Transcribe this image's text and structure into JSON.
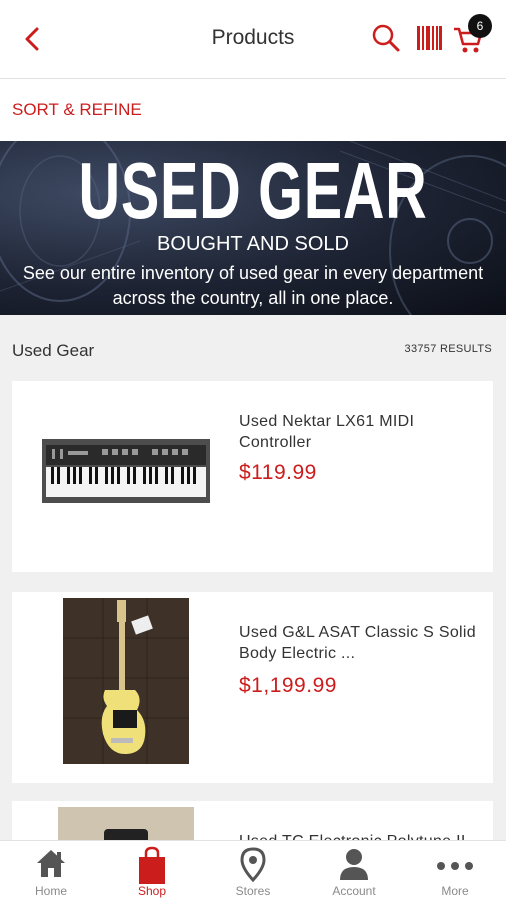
{
  "header": {
    "title": "Products",
    "cart_count": "6"
  },
  "sort_refine": "SORT & REFINE",
  "banner": {
    "title": "USED GEAR",
    "subtitle": "BOUGHT AND SOLD",
    "description": "See our entire inventory of used gear in every department across the country, all in one place."
  },
  "results": {
    "category": "Used Gear",
    "count": "33757 RESULTS"
  },
  "products": [
    {
      "name": "Used Nektar LX61 MIDI Controller",
      "price": "$119.99"
    },
    {
      "name": "Used G&L ASAT Classic S Solid Body Electric ...",
      "price": "$1,199.99"
    },
    {
      "name": "Used TC Electronic Polytune II",
      "price": ""
    }
  ],
  "tabs": [
    {
      "label": "Home",
      "icon": "home-icon"
    },
    {
      "label": "Shop",
      "icon": "shopping-bag-icon"
    },
    {
      "label": "Stores",
      "icon": "map-pin-icon"
    },
    {
      "label": "Account",
      "icon": "person-icon"
    },
    {
      "label": "More",
      "icon": "more-dots-icon"
    }
  ],
  "colors": {
    "accent": "#cc1d1d",
    "tab_inactive": "#8a8a8a",
    "banner_bg": "#1d2333"
  }
}
